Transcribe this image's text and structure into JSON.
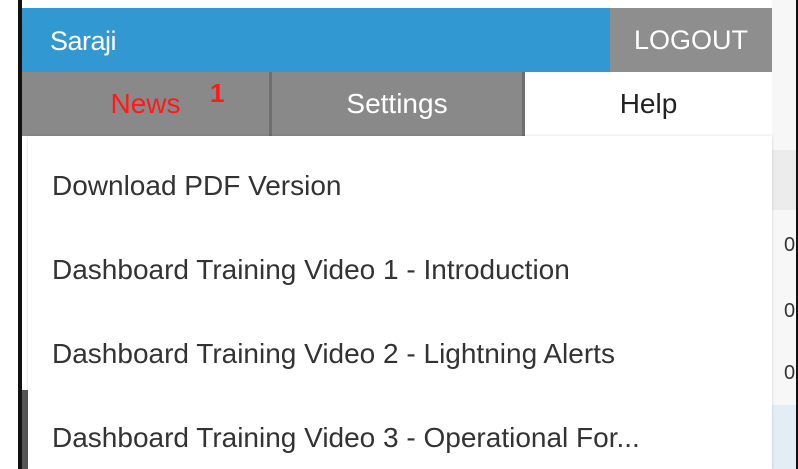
{
  "header": {
    "username": "Saraji",
    "logout_label": "LOGOUT"
  },
  "tabs": [
    {
      "label": "News",
      "badge": "1",
      "active": false
    },
    {
      "label": "Settings",
      "active": false
    },
    {
      "label": "Help",
      "active": true
    }
  ],
  "help_menu": {
    "items": [
      {
        "label": "Download PDF Version"
      },
      {
        "label": "Dashboard Training Video 1 - Introduction"
      },
      {
        "label": "Dashboard Training Video 2 - Lightning Alerts"
      },
      {
        "label": "Dashboard Training Video 3 - Operational For..."
      }
    ]
  },
  "background_values": [
    "0",
    "0",
    "0"
  ],
  "colors": {
    "header_bg": "#3298d1",
    "logout_bg": "#8e8e8e",
    "tab_bg": "#898989",
    "news_red": "#ff1a1a"
  }
}
